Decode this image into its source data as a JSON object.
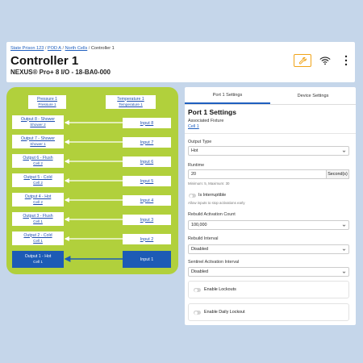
{
  "breadcrumb": [
    "State Prison 123",
    "POD A",
    "North Cells",
    "Controller 1"
  ],
  "header": {
    "title": "Controller 1",
    "subtitle": "NEXUS® Pro+ 8 I/O - 18-BA0-000",
    "accent_color": "#f0a419"
  },
  "diagram": {
    "background": "#b1d03c",
    "active_color": "#1d5bb5",
    "sensors": [
      {
        "label": "Pressure 1",
        "sub": "Pressure 1"
      },
      {
        "label": "Temperature 1",
        "sub": "Temperature 1"
      }
    ],
    "outputs": [
      {
        "label": "Output 8 - Shower",
        "sub": "Shower 2"
      },
      {
        "label": "Output 7 - Shower",
        "sub": "Shower 1"
      },
      {
        "label": "Output 6 - Flush",
        "sub": "Cell 2"
      },
      {
        "label": "Output 5 - Cold",
        "sub": "Cell 2"
      },
      {
        "label": "Output 4 - Hot",
        "sub": "Cell 2"
      },
      {
        "label": "Output 3 - Flush",
        "sub": "Cell 1"
      },
      {
        "label": "Output 2 - Cold",
        "sub": "Cell 1"
      },
      {
        "label": "Output 1 - Hot",
        "sub": "Cell 1"
      }
    ],
    "inputs": [
      "Input 8",
      "Input 7",
      "Input 6",
      "Input 5",
      "Input 4",
      "Input 3",
      "Input 2",
      "Input 1"
    ],
    "active_index": 7
  },
  "panel": {
    "tabs": [
      "Port 1 Settings",
      "Device Settings"
    ],
    "active_tab": 0,
    "title": "Port 1 Settings",
    "fixture_label": "Associated Fixture",
    "fixture_value": "Cell 1",
    "output_type_label": "Output Type",
    "output_type_value": "Hot",
    "runtime_label": "Runtime",
    "runtime_value": "20",
    "runtime_unit": "Second(s)",
    "runtime_hint": "Minimum: 5, Maximum: 30",
    "interruptible_label": "Is Interruptible",
    "interruptible_hint": "Allow inputs to stop activations early",
    "rebuild_count_label": "Rebuild Activation Count",
    "rebuild_count_value": "100,000",
    "rebuild_interval_label": "Rebuild Interval",
    "rebuild_interval_value": "Disabled",
    "sentinel_label": "Sentinel Activation Interval",
    "sentinel_value": "Disabled",
    "lockouts_label": "Enable Lockouts",
    "daily_lockout_label": "Enable Daily Lockout"
  }
}
